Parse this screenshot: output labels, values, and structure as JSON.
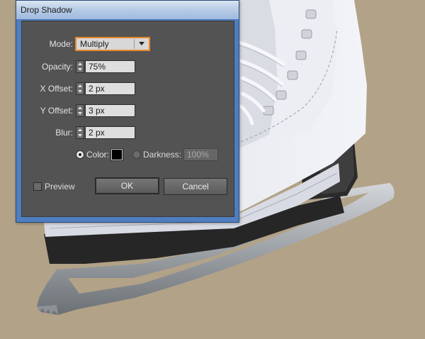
{
  "dialog": {
    "title": "Drop Shadow",
    "mode": {
      "label": "Mode:",
      "value": "Multiply"
    },
    "opacity": {
      "label": "Opacity:",
      "value": "75%"
    },
    "x_offset": {
      "label": "X Offset:",
      "value": "2 px"
    },
    "y_offset": {
      "label": "Y Offset:",
      "value": "3 px"
    },
    "blur": {
      "label": "Blur:",
      "value": "2 px"
    },
    "color": {
      "label": "Color:",
      "selected": true,
      "swatch": "#000000"
    },
    "darkness": {
      "label": "Darkness:",
      "value": "100%",
      "selected": false
    },
    "preview": {
      "label": "Preview",
      "checked": false
    },
    "ok_label": "OK",
    "cancel_label": "Cancel"
  },
  "colors": {
    "background": "#b2a287",
    "dialog_frame": "#4f7ec0",
    "dialog_panel": "#535353",
    "focus_outline": "#e88a2e"
  }
}
